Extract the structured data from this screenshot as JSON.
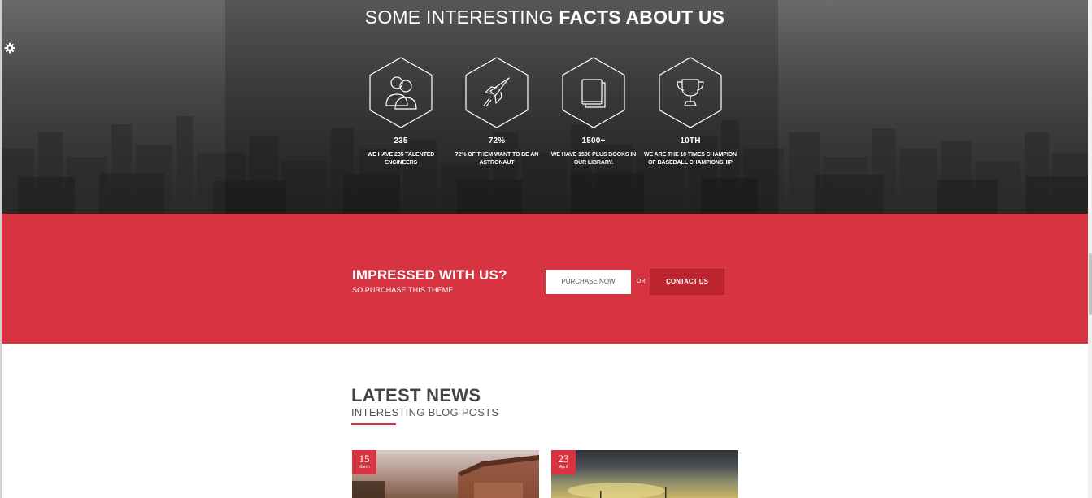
{
  "facts": {
    "title_light": "SOME INTERESTING",
    "title_bold": "FACTS ABOUT US",
    "items": [
      {
        "icon": "users-icon",
        "number": "235",
        "description": "WE HAVE 235 TALENTED ENGINEERS"
      },
      {
        "icon": "rocket-icon",
        "number": "72%",
        "description": "72% OF THEM WANT TO BE AN ASTRONAUT"
      },
      {
        "icon": "book-icon",
        "number": "1500+",
        "description": "WE HAVE 1500 PLUS BOOKS IN OUR LIBRARY."
      },
      {
        "icon": "trophy-icon",
        "number": "10TH",
        "description": "WE ARE THE 10 TIMES CHAMPION OF BASEBALL CHAMPIONSHIP"
      }
    ]
  },
  "settings": {
    "icon": "gear-icon"
  },
  "cta": {
    "heading": "IMPRESSED WITH US?",
    "subheading": "SO PURCHASE THIS THEME",
    "purchase_label": "PURCHASE NOW",
    "or_label": "OR",
    "contact_label": "CONTACT US"
  },
  "news": {
    "title": "LATEST NEWS",
    "subtitle": "INTERESTING BLOG POSTS",
    "posts": [
      {
        "day": "15",
        "month": "March"
      },
      {
        "day": "23",
        "month": "April"
      }
    ]
  },
  "colors": {
    "accent": "#d73340",
    "accent_dark": "#bf2530",
    "heading_text": "#444444"
  }
}
